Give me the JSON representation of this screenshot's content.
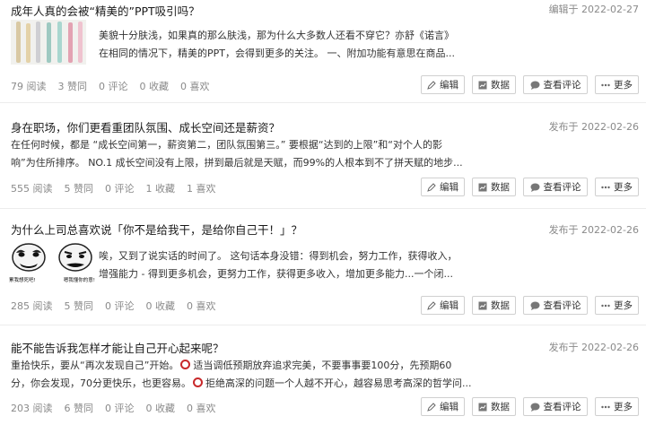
{
  "posts": [
    {
      "title": "成年人真的会被“精美的”PPT吸引吗？",
      "date": "编辑于 2022-02-27",
      "excerpt": [
        "美貌十分肤浅，如果真的那么肤浅，那为什么大多数人还看不穿它？亦舒《诺言》",
        "在相同的情况下，精美的PPT，会得到更多的关注。 一、附加功能有意思在商品..."
      ],
      "stats": [
        "79 阅读",
        "3 赞同",
        "0 评论",
        "0 收藏",
        "0 喜欢"
      ]
    },
    {
      "title": "身在职场，你们更看重团队氛围、成长空间还是薪资？",
      "date": "发布于 2022-02-26",
      "excerpt": [
        "在任何时候，都是 “成长空间第一，薪资第二，团队氛围第三。” 要根据“达到的上限”和“对个人的影",
        "响”为住所排序。 NO.1 成长空间没有上限，拼到最后就是天赋，而99%的人根本到不了拼天赋的地步..."
      ],
      "stats": [
        "555 阅读",
        "5 赞同",
        "0 评论",
        "1 收藏",
        "1 喜欢"
      ]
    },
    {
      "title": "为什么上司总喜欢说「你不是给我干，是给你自己干！」？",
      "date": "发布于 2022-02-26",
      "excerpt": [
        "唉，又到了说实话的时间了。 这句话本身没错：得到机会，努力工作，获得收入，",
        "增强能力 - 得到更多机会，更努力工作，获得更多收入，增加更多能力...一个闭..."
      ],
      "thumb_captions": [
        "累我想死吧!",
        "嗯我懂你的意!"
      ],
      "stats": [
        "285 阅读",
        "5 赞同",
        "0 评论",
        "0 收藏",
        "0 喜欢"
      ]
    },
    {
      "title": "能不能告诉我怎样才能让自己开心起来呢？",
      "date": "发布于 2022-02-26",
      "excerpt_a": [
        "重拾快乐，要从“再次发现自己”开始。",
        "适当调低预期放弃追求完美，不要事事要100分，先预期60"
      ],
      "excerpt_b": [
        "分，你会发现，70分更快乐，也更容易。",
        "拒绝高深的问题一个人越不开心，越容易思考高深的哲学问..."
      ],
      "stats": [
        "203 阅读",
        "6 赞同",
        "0 评论",
        "0 收藏",
        "0 喜欢"
      ]
    }
  ],
  "actions": {
    "edit": "编辑",
    "data": "数据",
    "comments": "查看评论",
    "more": "更多"
  },
  "icons": {
    "edit": "pencil-icon",
    "data": "chart-icon",
    "comments": "chat-bubble-icon",
    "more": "ellipsis-icon"
  },
  "colors": {
    "accent_ring": "#c8292b",
    "muted": "#8a8a8a"
  }
}
